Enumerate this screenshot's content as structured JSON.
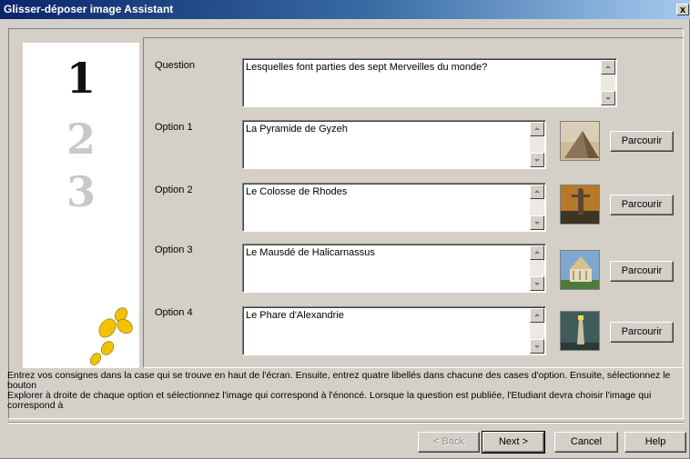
{
  "window": {
    "title": "Glisser-déposer image Assistant",
    "close_label": "x"
  },
  "steps": {
    "labels": [
      "1",
      "2",
      "3"
    ]
  },
  "form": {
    "question_label": "Question",
    "question_value": "Lesquelles font parties des sept Merveilles du monde?",
    "options": [
      {
        "label": "Option 1",
        "value": "La Pyramide de Gyzeh",
        "browse": "Parcourir",
        "image": "pyramid-thumbnail"
      },
      {
        "label": "Option 2",
        "value": "Le Colosse de Rhodes",
        "browse": "Parcourir",
        "image": "colossus-thumbnail"
      },
      {
        "label": "Option 3",
        "value": "Le Mausdé de Halicarnassus",
        "browse": "Parcourir",
        "image": "mausoleum-thumbnail"
      },
      {
        "label": "Option 4",
        "value": "Le Phare d'Alexandrie",
        "browse": "Parcourir",
        "image": "lighthouse-thumbnail"
      }
    ]
  },
  "instructions": {
    "line1": "Entrez vos consignes dans la case qui se trouve en haut de l'écran. Ensuite, entrez quatre libellés dans chacune des cases d'option. Ensuite, sélectionnez le bouton",
    "line2": "Explorer à droite de chaque option et sélectionnez l'image qui correspond à l'énoncé. Lorsque la question est publiée, l'Etudiant devra choisir l'image qui correspond à"
  },
  "footer": {
    "back": "< Back",
    "next": "Next >",
    "cancel": "Cancel",
    "help": "Help"
  },
  "colors": {
    "dialog_bg": "#d4d0c8",
    "title_start": "#0a246a",
    "title_end": "#a6caf0",
    "footprint": "#f2c200"
  }
}
